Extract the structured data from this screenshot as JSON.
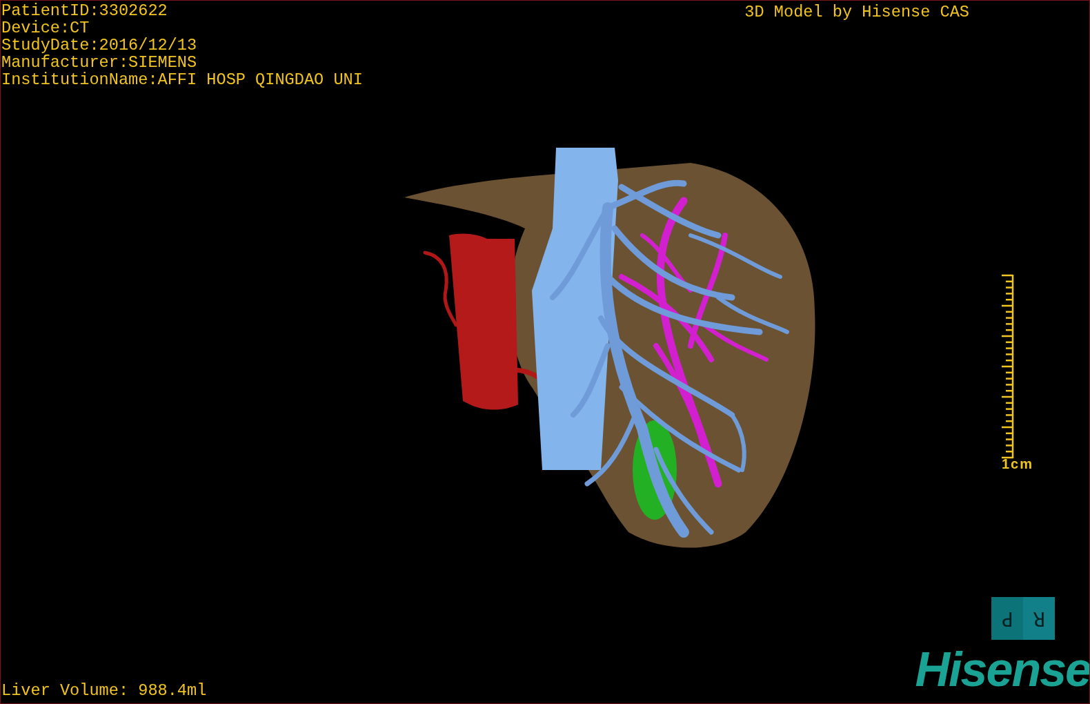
{
  "patient_info": [
    "PatientID:3302622",
    "Device:CT",
    "StudyDate:2016/12/13",
    "Manufacturer:SIEMENS",
    "InstitutionName:AFFI HOSP QINGDAO UNI"
  ],
  "title": "3D Model by Hisense CAS",
  "scale_bar": {
    "label": "1cm"
  },
  "orientation_cube": {
    "labels": [
      "P",
      "R"
    ]
  },
  "measurement": "Liver Volume: 988.4ml",
  "logo": "Hisense"
}
